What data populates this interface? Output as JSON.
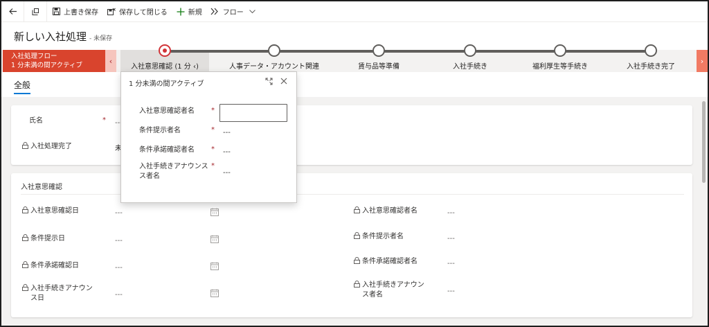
{
  "commandbar": {
    "back_icon": "back-arrow-icon",
    "popout_icon": "open-new-window-icon",
    "save_label": "上書き保存",
    "save_close_label": "保存して閉じる",
    "new_label": "新規",
    "flow_label": "フロー"
  },
  "header": {
    "title": "新しい入社処理",
    "status": "- 未保存"
  },
  "bpf": {
    "flow_name": "入社処理フロー",
    "flow_status": "1 分未満の間アクティブ",
    "stages": [
      {
        "label": "入社意思確認  (1 分 ‹)",
        "active": true
      },
      {
        "label": "人事データ・アカウント関連",
        "active": false
      },
      {
        "label": "賃与品等準備",
        "active": false
      },
      {
        "label": "入社手続き",
        "active": false
      },
      {
        "label": "福利厚生等手続き",
        "active": false
      },
      {
        "label": "入社手続き完了",
        "active": false
      }
    ],
    "colors": {
      "flow_bg": "#d9442d",
      "active_node": "#d13438"
    }
  },
  "tabs": [
    {
      "label": "全般"
    }
  ],
  "section1": {
    "fields": [
      {
        "label": "氏名",
        "value": "---",
        "required": true
      },
      {
        "label": "入社処理完了",
        "value": "未",
        "locked": true
      }
    ]
  },
  "section2": {
    "title": "入社意思確認",
    "left_fields": [
      {
        "label": "入社意思確認日",
        "value": "---"
      },
      {
        "label": "条件提示日",
        "value": "---"
      },
      {
        "label": "条件承諾確認日",
        "value": "---"
      },
      {
        "label_line1": "入社手続きアナウン",
        "label_line2": "ス日",
        "value": "---"
      }
    ],
    "right_fields": [
      {
        "label": "入社意思確認者名",
        "value": "---"
      },
      {
        "label": "条件提示者名",
        "value": "---"
      },
      {
        "label": "条件承諾確認者名",
        "value": "---"
      },
      {
        "label_line1": "入社手続きアナウン",
        "label_line2": "ス者名",
        "value": "---"
      }
    ]
  },
  "flyout": {
    "title": "1 分未満の間アクティブ",
    "fields": [
      {
        "label": "入社意思確認者名",
        "value": ""
      },
      {
        "label": "条件提示者名",
        "value": "---"
      },
      {
        "label": "条件承諾確認者名",
        "value": "---"
      },
      {
        "label_line1": "入社手続きアナウンス",
        "label_line2": "ス者名",
        "value": "---"
      }
    ]
  }
}
